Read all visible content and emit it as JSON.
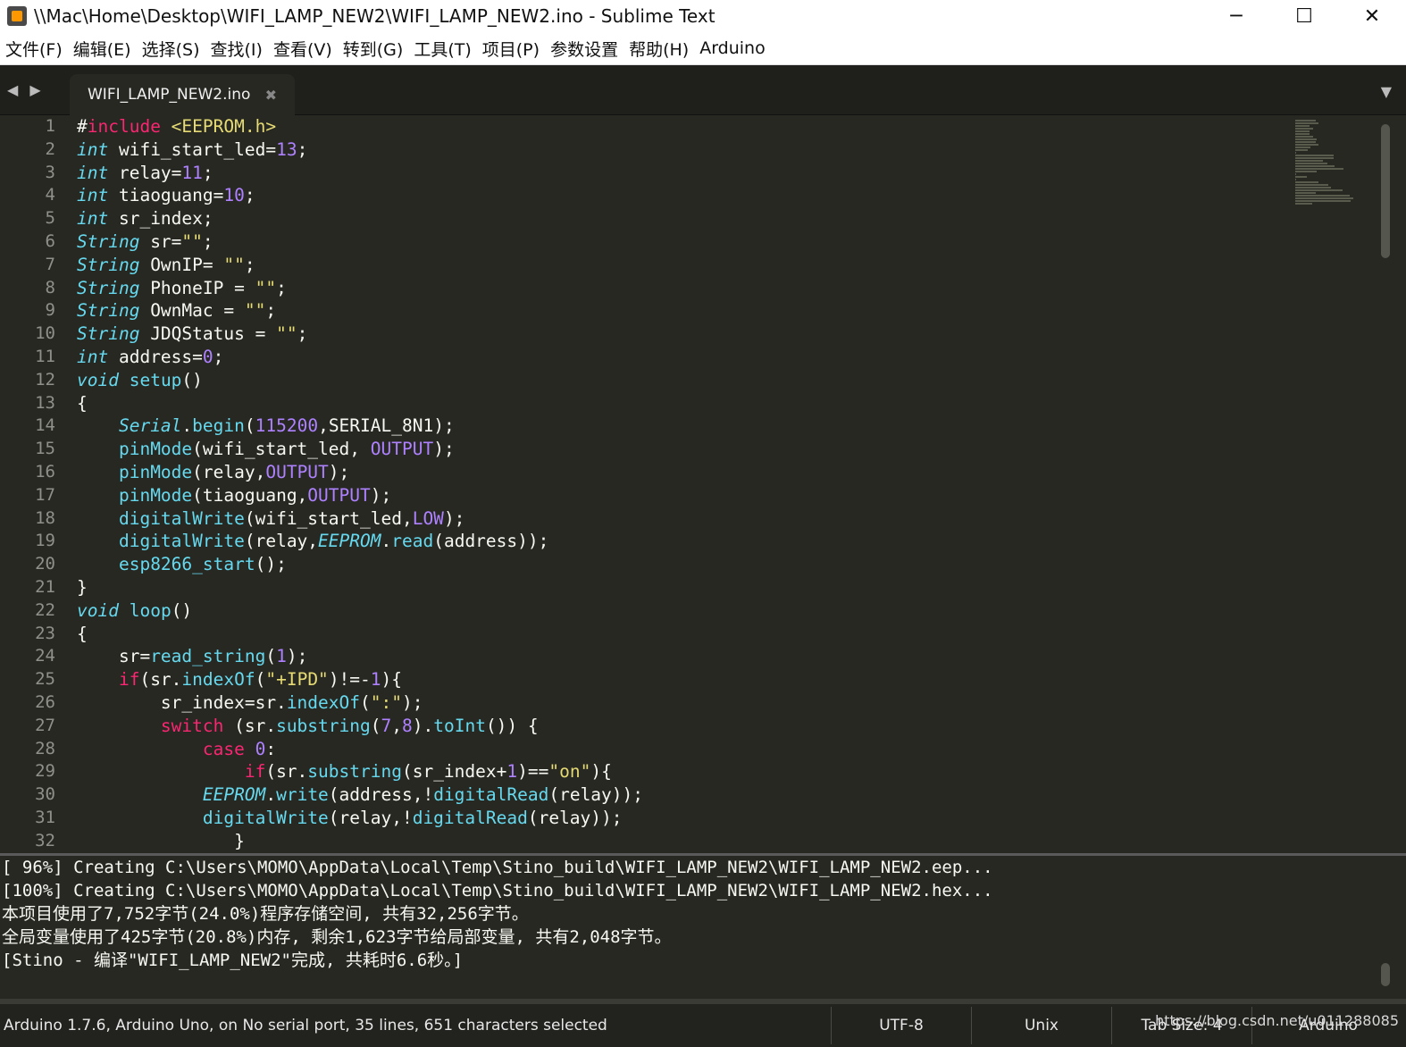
{
  "window": {
    "title": "\\\\Mac\\Home\\Desktop\\WIFI_LAMP_NEW2\\WIFI_LAMP_NEW2.ino - Sublime Text",
    "minimize": "─",
    "maximize": "☐",
    "close": "✕"
  },
  "menu": [
    "文件(F)",
    "编辑(E)",
    "选择(S)",
    "查找(I)",
    "查看(V)",
    "转到(G)",
    "工具(T)",
    "项目(P)",
    "参数设置",
    "帮助(H)",
    "Arduino"
  ],
  "tabbar": {
    "arrows": "◀ ▶",
    "tab_label": "WIFI_LAMP_NEW2.ino",
    "tab_close": "✖",
    "dropdown": "▼"
  },
  "editor": {
    "lines": [
      [
        [
          "#",
          "o"
        ],
        [
          "include",
          "k"
        ],
        [
          " <EEPROM.h>",
          "s"
        ]
      ],
      [
        [
          "int",
          "t"
        ],
        [
          " wifi_start_led=",
          "o"
        ],
        [
          "13",
          "n"
        ],
        [
          ";",
          "o"
        ]
      ],
      [
        [
          "int",
          "t"
        ],
        [
          " relay=",
          "o"
        ],
        [
          "11",
          "n"
        ],
        [
          ";",
          "o"
        ]
      ],
      [
        [
          "int",
          "t"
        ],
        [
          " tiaoguang=",
          "o"
        ],
        [
          "10",
          "n"
        ],
        [
          ";",
          "o"
        ]
      ],
      [
        [
          "int",
          "t"
        ],
        [
          " sr_index;",
          "o"
        ]
      ],
      [
        [
          "String",
          "t"
        ],
        [
          " sr=",
          "o"
        ],
        [
          "\"\"",
          "s"
        ],
        [
          ";",
          "o"
        ]
      ],
      [
        [
          "String",
          "t"
        ],
        [
          " OwnIP= ",
          "o"
        ],
        [
          "\"\"",
          "s"
        ],
        [
          ";",
          "o"
        ]
      ],
      [
        [
          "String",
          "t"
        ],
        [
          " PhoneIP = ",
          "o"
        ],
        [
          "\"\"",
          "s"
        ],
        [
          ";",
          "o"
        ]
      ],
      [
        [
          "String",
          "t"
        ],
        [
          " OwnMac = ",
          "o"
        ],
        [
          "\"\"",
          "s"
        ],
        [
          ";",
          "o"
        ]
      ],
      [
        [
          "String",
          "t"
        ],
        [
          " JDQStatus = ",
          "o"
        ],
        [
          "\"\"",
          "s"
        ],
        [
          ";",
          "o"
        ]
      ],
      [
        [
          "int",
          "t"
        ],
        [
          " address=",
          "o"
        ],
        [
          "0",
          "n"
        ],
        [
          ";",
          "o"
        ]
      ],
      [
        [
          "void",
          "t"
        ],
        [
          " ",
          "o"
        ],
        [
          "setup",
          "f"
        ],
        [
          "()",
          "o"
        ]
      ],
      [
        [
          "{",
          "o"
        ]
      ],
      [
        [
          "    ",
          "o"
        ],
        [
          "Serial",
          "t"
        ],
        [
          ".",
          "o"
        ],
        [
          "begin",
          "f"
        ],
        [
          "(",
          "o"
        ],
        [
          "115200",
          "n"
        ],
        [
          ",SERIAL_8N1);",
          "o"
        ]
      ],
      [
        [
          "    ",
          "o"
        ],
        [
          "pinMode",
          "f"
        ],
        [
          "(wifi_start_led, ",
          "o"
        ],
        [
          "OUTPUT",
          "n"
        ],
        [
          ");",
          "o"
        ]
      ],
      [
        [
          "    ",
          "o"
        ],
        [
          "pinMode",
          "f"
        ],
        [
          "(relay,",
          "o"
        ],
        [
          "OUTPUT",
          "n"
        ],
        [
          ");",
          "o"
        ]
      ],
      [
        [
          "    ",
          "o"
        ],
        [
          "pinMode",
          "f"
        ],
        [
          "(tiaoguang,",
          "o"
        ],
        [
          "OUTPUT",
          "n"
        ],
        [
          ");",
          "o"
        ]
      ],
      [
        [
          "    ",
          "o"
        ],
        [
          "digitalWrite",
          "f"
        ],
        [
          "(wifi_start_led,",
          "o"
        ],
        [
          "LOW",
          "n"
        ],
        [
          ");",
          "o"
        ]
      ],
      [
        [
          "    ",
          "o"
        ],
        [
          "digitalWrite",
          "f"
        ],
        [
          "(relay,",
          "o"
        ],
        [
          "EEPROM",
          "t"
        ],
        [
          ".",
          "o"
        ],
        [
          "read",
          "f"
        ],
        [
          "(address));",
          "o"
        ]
      ],
      [
        [
          "    ",
          "o"
        ],
        [
          "esp8266_start",
          "f"
        ],
        [
          "();",
          "o"
        ]
      ],
      [
        [
          "}",
          "o"
        ]
      ],
      [
        [
          "void",
          "t"
        ],
        [
          " ",
          "o"
        ],
        [
          "loop",
          "f"
        ],
        [
          "()",
          "o"
        ]
      ],
      [
        [
          "{",
          "o"
        ]
      ],
      [
        [
          "    sr=",
          "o"
        ],
        [
          "read_string",
          "f"
        ],
        [
          "(",
          "o"
        ],
        [
          "1",
          "n"
        ],
        [
          ");",
          "o"
        ]
      ],
      [
        [
          "    ",
          "o"
        ],
        [
          "if",
          "k"
        ],
        [
          "(sr.",
          "o"
        ],
        [
          "indexOf",
          "f"
        ],
        [
          "(",
          "o"
        ],
        [
          "\"+IPD\"",
          "s"
        ],
        [
          ")!=-",
          "o"
        ],
        [
          "1",
          "n"
        ],
        [
          "){",
          "o"
        ]
      ],
      [
        [
          "        sr_index=sr.",
          "o"
        ],
        [
          "indexOf",
          "f"
        ],
        [
          "(",
          "o"
        ],
        [
          "\":\"",
          "s"
        ],
        [
          ");",
          "o"
        ]
      ],
      [
        [
          "        ",
          "o"
        ],
        [
          "switch",
          "k"
        ],
        [
          " (sr.",
          "o"
        ],
        [
          "substring",
          "f"
        ],
        [
          "(",
          "o"
        ],
        [
          "7",
          "n"
        ],
        [
          ",",
          "o"
        ],
        [
          "8",
          "n"
        ],
        [
          ").",
          "o"
        ],
        [
          "toInt",
          "f"
        ],
        [
          "()) {",
          "o"
        ]
      ],
      [
        [
          "            ",
          "o"
        ],
        [
          "case",
          "k"
        ],
        [
          " ",
          "o"
        ],
        [
          "0",
          "n"
        ],
        [
          ":",
          "o"
        ]
      ],
      [
        [
          "                ",
          "o"
        ],
        [
          "if",
          "k"
        ],
        [
          "(sr.",
          "o"
        ],
        [
          "substring",
          "f"
        ],
        [
          "(sr_index+",
          "o"
        ],
        [
          "1",
          "n"
        ],
        [
          ")==",
          "o"
        ],
        [
          "\"on\"",
          "s"
        ],
        [
          "){",
          "o"
        ]
      ],
      [
        [
          "            ",
          "o"
        ],
        [
          "EEPROM",
          "t"
        ],
        [
          ".",
          "o"
        ],
        [
          "write",
          "f"
        ],
        [
          "(address,!",
          "o"
        ],
        [
          "digitalRead",
          "f"
        ],
        [
          "(relay));",
          "o"
        ]
      ],
      [
        [
          "            ",
          "o"
        ],
        [
          "digitalWrite",
          "f"
        ],
        [
          "(relay,!",
          "o"
        ],
        [
          "digitalRead",
          "f"
        ],
        [
          "(relay));",
          "o"
        ]
      ],
      [
        [
          "               }",
          "o"
        ]
      ]
    ]
  },
  "output": [
    "[ 96%] Creating C:\\Users\\MOMO\\AppData\\Local\\Temp\\Stino_build\\WIFI_LAMP_NEW2\\WIFI_LAMP_NEW2.eep...",
    "[100%] Creating C:\\Users\\MOMO\\AppData\\Local\\Temp\\Stino_build\\WIFI_LAMP_NEW2\\WIFI_LAMP_NEW2.hex...",
    "本项目使用了7,752字节(24.0%)程序存储空间, 共有32,256字节。",
    "全局变量使用了425字节(20.8%)内存, 剩余1,623字节给局部变量, 共有2,048字节。",
    "[Stino - 编译\"WIFI_LAMP_NEW2\"完成, 共耗时6.6秒。]"
  ],
  "status": {
    "main": "Arduino 1.7.6, Arduino Uno, on No serial port, 35 lines, 651 characters selected",
    "encoding": "UTF-8",
    "line_endings": "Unix",
    "tab_size": "Tab Size: 4",
    "syntax": "Arduino"
  },
  "watermark": "https://blog.csdn.net/u011288085"
}
